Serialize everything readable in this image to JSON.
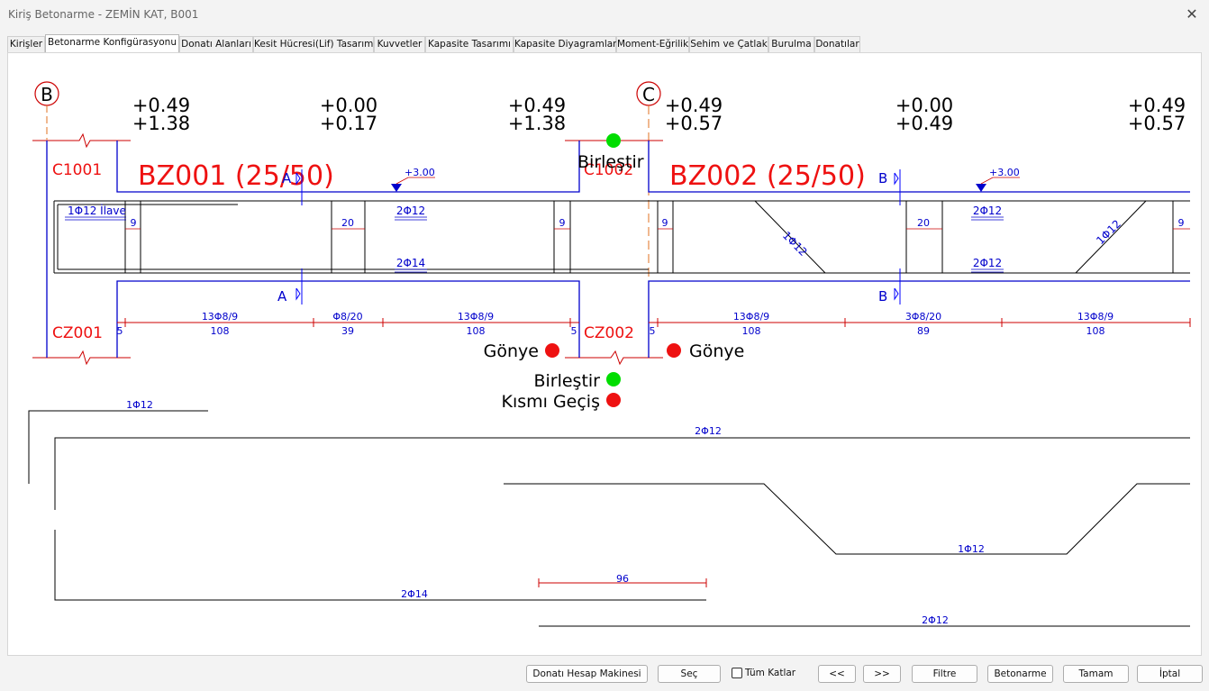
{
  "window": {
    "title": "Kiriş Betonarme - ZEMİN KAT, B001"
  },
  "tabs": [
    "Kirişler",
    "Betonarme Konfigürasyonu",
    "Donatı Alanları",
    "Kesit Hücresi(Lif) Tasarımı",
    "Kuvvetler",
    "Kapasite Tasarımı",
    "Kapasite Diyagramları",
    "Moment-Eğrilik",
    "Sehim ve Çatlak",
    "Burulma",
    "Donatılar"
  ],
  "active_tab": "Betonarme Konfigürasyonu",
  "drawing": {
    "axes": {
      "b": "B",
      "c": "C"
    },
    "moments": {
      "m1": [
        "+0.49",
        "+1.38"
      ],
      "m2": [
        "+0.00",
        "+0.17"
      ],
      "m3": [
        "+0.49",
        "+1.38"
      ],
      "m4": [
        "+0.49",
        "+0.57"
      ],
      "m5": [
        "+0.00",
        "+0.49"
      ],
      "m6": [
        "+0.49",
        "+0.57"
      ]
    },
    "columns": {
      "c1001": "C1001",
      "c1002": "C1002",
      "cz001": "CZ001",
      "cz002": "CZ002"
    },
    "beams": {
      "bz001": "BZ001 (25/50)",
      "bz002": "BZ002 (25/50)"
    },
    "elev": {
      "b1": "+3.00",
      "b2": "+3.00"
    },
    "sections": {
      "a": "A",
      "b": "B"
    },
    "rebar": {
      "ilave": "1Φ12 İlave",
      "b1_top": "2Φ12",
      "b1_bottom": "2Φ14",
      "b2_top": "2Φ12",
      "b2_bottom": "2Φ12",
      "b2_bent": "1Φ12",
      "dims": {
        "d9": "9",
        "d20": "20"
      }
    },
    "stirrups": {
      "b1": [
        {
          "label": "13Φ8/9",
          "len": "108"
        },
        {
          "label": "Φ8/20",
          "len": "39"
        },
        {
          "label": "13Φ8/9",
          "len": "108"
        }
      ],
      "b2": [
        {
          "label": "13Φ8/9",
          "len": "108"
        },
        {
          "label": "3Φ8/20",
          "len": "89"
        },
        {
          "label": "13Φ8/9",
          "len": "108"
        }
      ],
      "end_gap": "5"
    },
    "status": {
      "birlestir": "Birleştir",
      "gonye": "Gönye",
      "kismi": "Kısmı Geçiş",
      "green": "#00dd00",
      "red": "#ee1111"
    },
    "details": {
      "top_left": "1Φ12",
      "top_long": "2Φ12",
      "bent": "1Φ12",
      "dim96": "96",
      "bottom_left": "2Φ14",
      "bottom_right": "2Φ12"
    }
  },
  "buttons": {
    "calc": "Donatı Hesap Makinesi",
    "sec": "Seç",
    "tum_katlar": "Tüm Katlar",
    "prev": "<<",
    "next": ">>",
    "filtre": "Filtre",
    "betonarme": "Betonarme",
    "tamam": "Tamam",
    "iptal": "İptal"
  },
  "colors": {
    "beam_label": "#ee1111",
    "drawing_blue": "#0000cc",
    "section_line": "#0000ff"
  }
}
